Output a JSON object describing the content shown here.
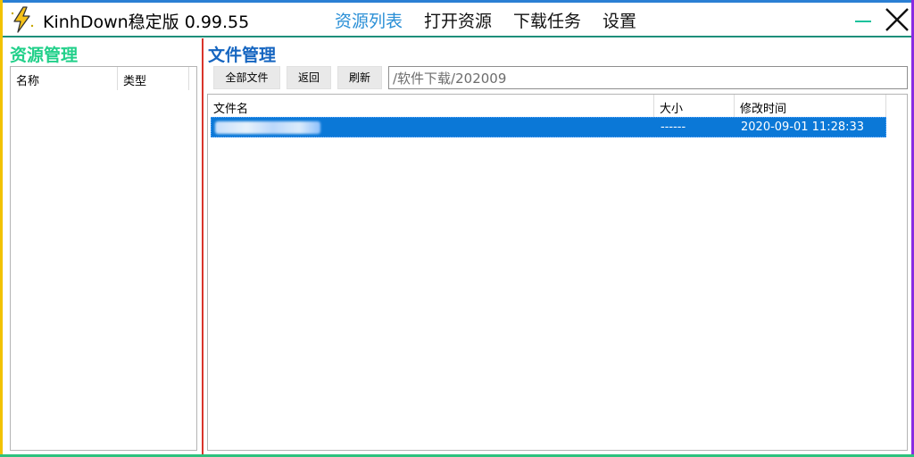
{
  "window": {
    "title": "KinhDown稳定版 0.99.55",
    "colors": {
      "top": "#2a7fd4",
      "left": "#f2c200",
      "right": "#8a2be2",
      "bottom": "#2ec27e",
      "accent": "#2a8fd6"
    }
  },
  "nav": {
    "items": [
      {
        "label": "资源列表",
        "active": true
      },
      {
        "label": "打开资源",
        "active": false
      },
      {
        "label": "下载任务",
        "active": false
      },
      {
        "label": "设置",
        "active": false
      }
    ]
  },
  "left_panel": {
    "title": "资源管理",
    "columns": [
      "名称",
      "类型"
    ]
  },
  "right_panel": {
    "title": "文件管理",
    "buttons": {
      "all_files": "全部文件",
      "back": "返回",
      "refresh": "刷新"
    },
    "path": "/软件下载/202009",
    "columns": [
      "文件名",
      "大小",
      "修改时间"
    ],
    "rows": [
      {
        "name": "",
        "size": "------",
        "modified": "2020-09-01 11:28:33",
        "selected": true
      }
    ]
  },
  "icons": {
    "app": "lightning-icon",
    "minimize": "minimize-icon",
    "close": "close-icon"
  }
}
